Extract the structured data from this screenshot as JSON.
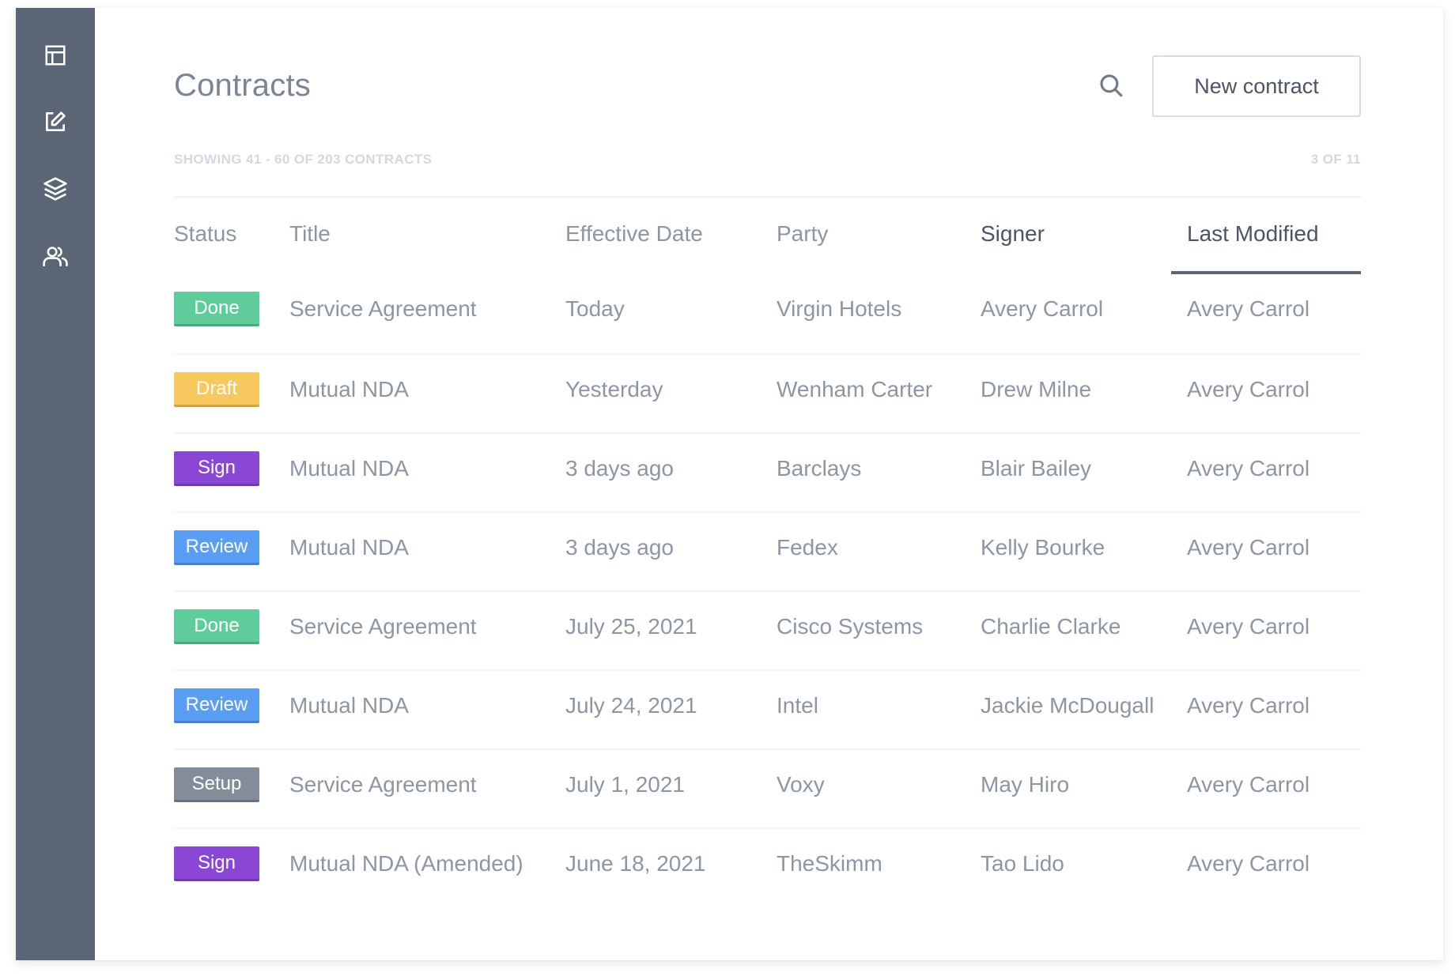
{
  "sidebar": {
    "items": [
      {
        "icon": "layout-icon",
        "name": "sidebar-item-dashboard"
      },
      {
        "icon": "edit-icon",
        "name": "sidebar-item-contracts"
      },
      {
        "icon": "layers-icon",
        "name": "sidebar-item-templates"
      },
      {
        "icon": "users-icon",
        "name": "sidebar-item-people"
      }
    ]
  },
  "header": {
    "title": "Contracts",
    "new_button_label": "New contract",
    "search_icon": "search-icon"
  },
  "summary": {
    "showing": "SHOWING 41 - 60 OF 203 CONTRACTS",
    "page": "3 OF 11"
  },
  "colors": {
    "sidebar": "#5a6575",
    "done": "#5fcd9b",
    "draft": "#f7c85d",
    "sign": "#8a47d6",
    "review": "#5a9df5",
    "setup": "#828d99"
  },
  "table": {
    "columns": [
      "Status",
      "Title",
      "Effective Date",
      "Party",
      "Signer",
      "Last Modified"
    ],
    "sorted_column": "Last Modified",
    "rows": [
      {
        "status": "Done",
        "title": "Service Agreement",
        "effective_date": "Today",
        "party": "Virgin Hotels",
        "signer": "Avery Carrol",
        "last_modified": "Avery Carrol"
      },
      {
        "status": "Draft",
        "title": "Mutual NDA",
        "effective_date": "Yesterday",
        "party": "Wenham Carter",
        "signer": "Drew Milne",
        "last_modified": "Avery Carrol"
      },
      {
        "status": "Sign",
        "title": "Mutual NDA",
        "effective_date": "3 days ago",
        "party": "Barclays",
        "signer": "Blair Bailey",
        "last_modified": "Avery Carrol"
      },
      {
        "status": "Review",
        "title": "Mutual NDA",
        "effective_date": "3 days ago",
        "party": "Fedex",
        "signer": "Kelly Bourke",
        "last_modified": "Avery Carrol"
      },
      {
        "status": "Done",
        "title": "Service Agreement",
        "effective_date": "July 25, 2021",
        "party": "Cisco Systems",
        "signer": "Charlie Clarke",
        "last_modified": "Avery Carrol"
      },
      {
        "status": "Review",
        "title": "Mutual NDA",
        "effective_date": "July 24, 2021",
        "party": "Intel",
        "signer": "Jackie McDougall",
        "last_modified": "Avery Carrol"
      },
      {
        "status": "Setup",
        "title": "Service Agreement",
        "effective_date": "July 1, 2021",
        "party": "Voxy",
        "signer": "May Hiro",
        "last_modified": "Avery Carrol"
      },
      {
        "status": "Sign",
        "title": "Mutual NDA (Amended)",
        "effective_date": "June 18, 2021",
        "party": "TheSkimm",
        "signer": "Tao Lido",
        "last_modified": "Avery Carrol"
      }
    ]
  }
}
